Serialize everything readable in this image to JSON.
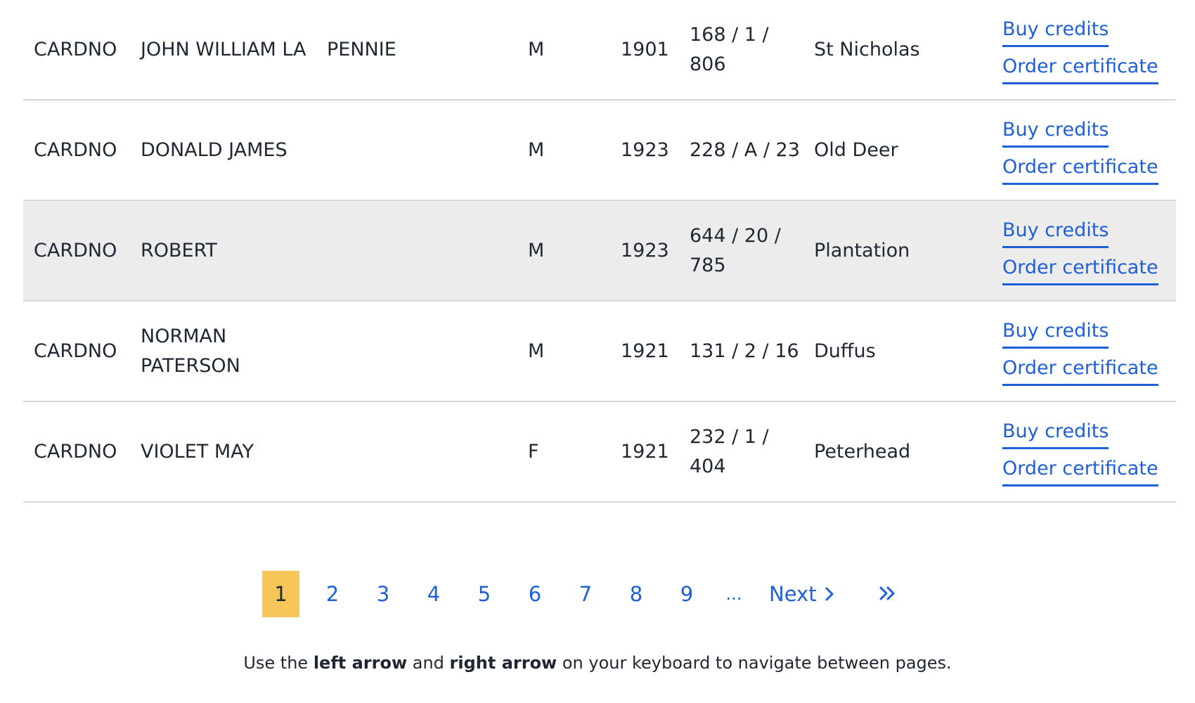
{
  "rows": [
    {
      "surname": "CARDNO",
      "forename": "JOHN WILLIAM LA",
      "other": "PENNIE",
      "sex": "M",
      "year": "1901",
      "ref": "168 / 1 / 806",
      "district": "St Nicholas",
      "buy": "Buy credits",
      "order": "Order certificate"
    },
    {
      "surname": "CARDNO",
      "forename": "DONALD JAMES",
      "other": "",
      "sex": "M",
      "year": "1923",
      "ref": "228 / A / 23",
      "district": "Old Deer",
      "buy": "Buy credits",
      "order": "Order certificate"
    },
    {
      "surname": "CARDNO",
      "forename": "ROBERT",
      "other": "",
      "sex": "M",
      "year": "1923",
      "ref": "644 / 20 / 785",
      "district": "Plantation",
      "buy": "Buy credits",
      "order": "Order certificate"
    },
    {
      "surname": "CARDNO",
      "forename": "NORMAN PATERSON",
      "other": "",
      "sex": "M",
      "year": "1921",
      "ref": "131 / 2 / 16",
      "district": "Duffus",
      "buy": "Buy credits",
      "order": "Order certificate"
    },
    {
      "surname": "CARDNO",
      "forename": "VIOLET MAY",
      "other": "",
      "sex": "F",
      "year": "1921",
      "ref": "232 / 1 / 404",
      "district": "Peterhead",
      "buy": "Buy credits",
      "order": "Order certificate"
    }
  ],
  "pagination": {
    "pages": [
      "1",
      "2",
      "3",
      "4",
      "5",
      "6",
      "7",
      "8",
      "9"
    ],
    "current": "1",
    "ellipsis": "...",
    "next_label": "Next",
    "last_icon": "double-chevron-right-icon"
  },
  "hint": {
    "prefix": "Use the ",
    "left": "left arrow",
    "middle": " and ",
    "right": "right arrow",
    "suffix": " on your keyboard to navigate between pages."
  },
  "colors": {
    "link": "#1f5fd6",
    "current_page": "#f6c758",
    "highlight_row": "#ececec"
  }
}
